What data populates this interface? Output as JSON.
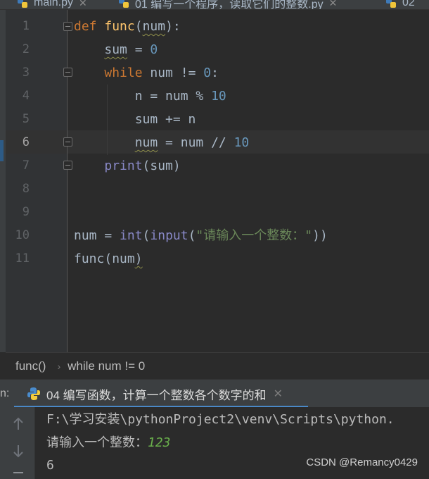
{
  "tabs": [
    {
      "label": "main.py",
      "active": false
    },
    {
      "label": "01 编写一个程序，读取它们的整数.py",
      "active": false
    },
    {
      "label": "02",
      "active": false
    }
  ],
  "editor": {
    "line_numbers": [
      "1",
      "2",
      "3",
      "4",
      "5",
      "6",
      "7",
      "8",
      "9",
      "10",
      "11"
    ],
    "current_line": 6,
    "lines": [
      [
        {
          "t": "def ",
          "c": "kw"
        },
        {
          "t": "func",
          "c": "fn"
        },
        {
          "t": "(",
          "c": ""
        },
        {
          "t": "num",
          "c": "squig"
        },
        {
          "t": "):",
          "c": ""
        }
      ],
      [
        {
          "t": "    ",
          "c": ""
        },
        {
          "t": "sum",
          "c": "squig"
        },
        {
          "t": " = ",
          "c": ""
        },
        {
          "t": "0",
          "c": "num"
        }
      ],
      [
        {
          "t": "    ",
          "c": ""
        },
        {
          "t": "while",
          "c": "kw"
        },
        {
          "t": " num != ",
          "c": ""
        },
        {
          "t": "0",
          "c": "num"
        },
        {
          "t": ":",
          "c": ""
        }
      ],
      [
        {
          "t": "        n = num % ",
          "c": ""
        },
        {
          "t": "10",
          "c": "num"
        }
      ],
      [
        {
          "t": "        sum += n",
          "c": ""
        }
      ],
      [
        {
          "t": "        ",
          "c": ""
        },
        {
          "t": "num",
          "c": "squig"
        },
        {
          "t": " = num // ",
          "c": ""
        },
        {
          "t": "10",
          "c": "num"
        }
      ],
      [
        {
          "t": "    ",
          "c": ""
        },
        {
          "t": "print",
          "c": "bi"
        },
        {
          "t": "(sum)",
          "c": ""
        }
      ],
      [],
      [],
      [
        {
          "t": "num = ",
          "c": ""
        },
        {
          "t": "int",
          "c": "bi"
        },
        {
          "t": "(",
          "c": ""
        },
        {
          "t": "input",
          "c": "bi"
        },
        {
          "t": "(",
          "c": ""
        },
        {
          "t": "\"请输入一个整数：\"",
          "c": "str"
        },
        {
          "t": "))",
          "c": ""
        }
      ],
      [
        {
          "t": "func(",
          "c": ""
        },
        {
          "t": "num",
          "c": ""
        },
        {
          "t": ")",
          "c": "squig"
        }
      ]
    ]
  },
  "breadcrumb": {
    "items": [
      "func()",
      "while num != 0"
    ]
  },
  "run": {
    "label": "n:",
    "tab_title": "04 编写函数，计算一个整数各个数字的和",
    "console": {
      "line1": "F:\\学习安装\\pythonProject2\\venv\\Scripts\\python.",
      "prompt": "请输入一个整数：",
      "input_value": "123",
      "output": "6"
    }
  },
  "watermark": "CSDN @Remancy0429",
  "colors": {
    "keyword": "#cc7832",
    "function": "#ffc66d",
    "number": "#6897bb",
    "builtin": "#8888c6",
    "string": "#6a8759",
    "accent": "#4a88c7"
  }
}
